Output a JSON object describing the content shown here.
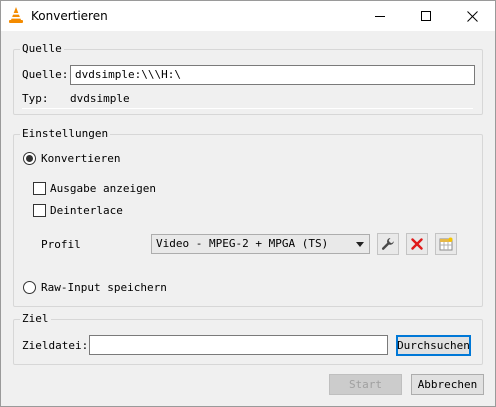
{
  "window": {
    "title": "Konvertieren"
  },
  "source": {
    "group_label": "Quelle",
    "field_label": "Quelle:",
    "field_value": "dvdsimple:\\\\\\H:\\",
    "type_label": "Typ:",
    "type_value": "dvdsimple"
  },
  "settings": {
    "group_label": "Einstellungen",
    "convert_label": "Konvertieren",
    "convert_selected": true,
    "show_output_label": "Ausgabe anzeigen",
    "deinterlace_label": "Deinterlace",
    "profile_label": "Profil",
    "profile_value": "Video - MPEG-2 + MPGA (TS)",
    "raw_input_label": "Raw-Input speichern"
  },
  "destination": {
    "group_label": "Ziel",
    "file_label": "Zieldatei:",
    "file_value": "",
    "browse_label": "Durchsuchen"
  },
  "buttons": {
    "start_label": "Start",
    "cancel_label": "Abbrechen"
  },
  "icons": {
    "app": "vlc-cone-icon",
    "edit_profile": "wrench-icon",
    "delete_profile": "red-x-icon",
    "new_profile": "new-profile-grid-icon"
  },
  "colors": {
    "accent": "#0078d7",
    "vlc_orange": "#f48b00",
    "delete_red": "#e01b1b"
  }
}
